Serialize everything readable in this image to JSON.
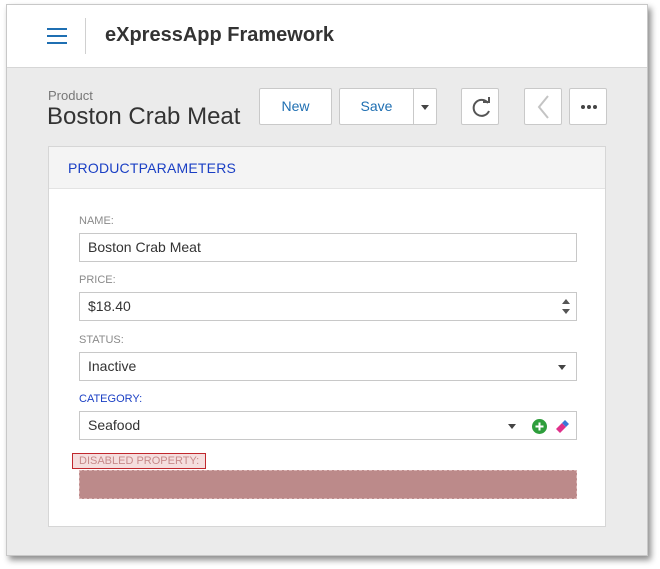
{
  "app": {
    "title": "eXpressApp Framework"
  },
  "header": {
    "object_type": "Product",
    "view_title": "Boston Crab Meat"
  },
  "toolbar": {
    "new_label": "New",
    "save_label": "Save"
  },
  "panel": {
    "title": "PRODUCTPARAMETERS"
  },
  "fields": {
    "name": {
      "label": "NAME:",
      "value": "Boston Crab Meat"
    },
    "price": {
      "label": "PRICE:",
      "value": "$18.40"
    },
    "status": {
      "label": "STATUS:",
      "value": "Inactive"
    },
    "category": {
      "label": "CATEGORY:",
      "value": "Seafood"
    },
    "disabled": {
      "label": "DISABLED PROPERTY:",
      "value": ""
    }
  },
  "colors": {
    "accent": "#1f6fb2",
    "category_label": "#1a3fc4",
    "add_icon": "#2e9e3c",
    "disabled_fill": "#bc8a8a",
    "disabled_border": "#c0272d"
  },
  "icons": [
    "menu-icon",
    "caret-down-icon",
    "refresh-icon",
    "chevron-left-icon",
    "more-dots-icon",
    "spin-up-icon",
    "spin-down-icon",
    "plus-circle-icon",
    "eraser-icon"
  ]
}
